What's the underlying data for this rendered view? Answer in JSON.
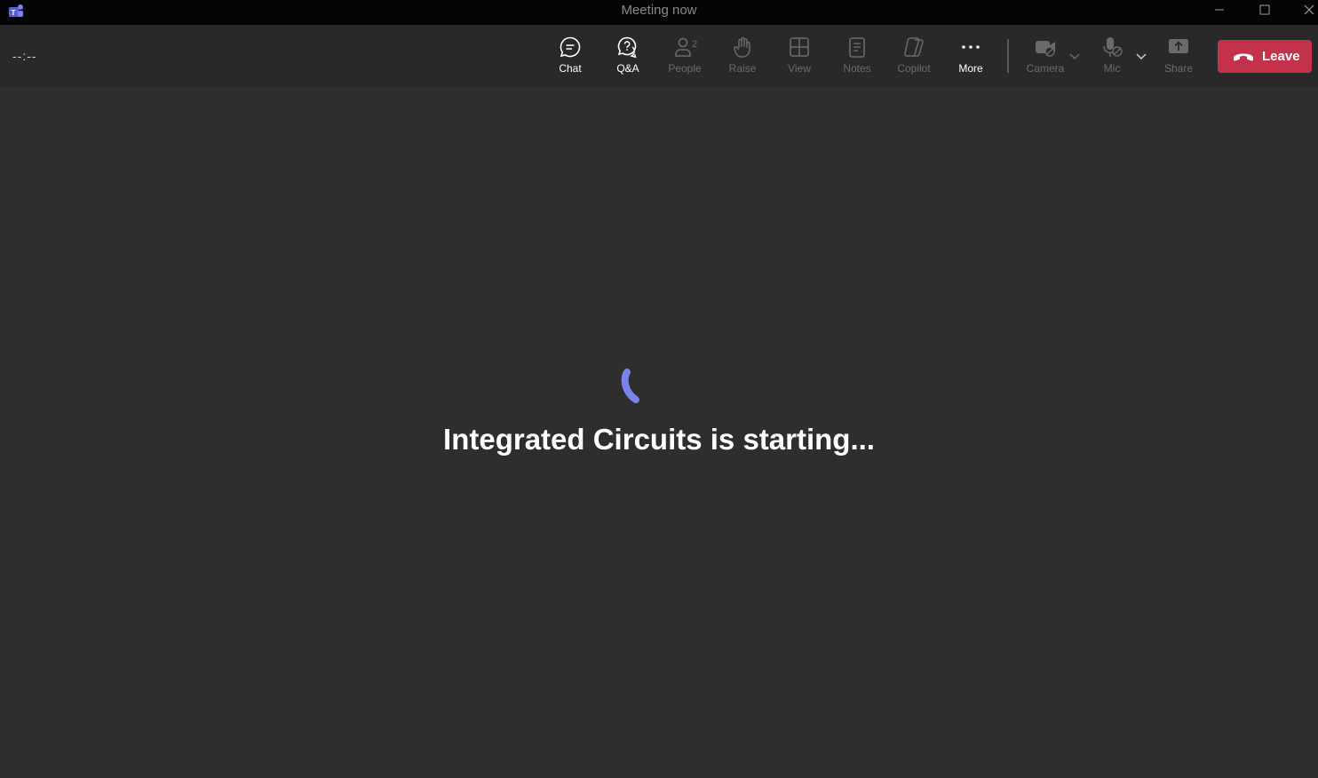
{
  "window": {
    "title": "Meeting now",
    "controls": [
      "minimize-icon",
      "maximize-icon",
      "close-icon"
    ]
  },
  "toolbar": {
    "timer": "--:--",
    "buttons": {
      "chat": {
        "label": "Chat",
        "icon": "chat-icon",
        "enabled": true
      },
      "qa": {
        "label": "Q&A",
        "icon": "qa-icon",
        "enabled": true
      },
      "people": {
        "label": "People",
        "icon": "people-icon",
        "count": "2",
        "enabled": false
      },
      "raise": {
        "label": "Raise",
        "icon": "raise-hand-icon",
        "enabled": false
      },
      "view": {
        "label": "View",
        "icon": "view-grid-icon",
        "enabled": false
      },
      "notes": {
        "label": "Notes",
        "icon": "notes-icon",
        "enabled": false
      },
      "copilot": {
        "label": "Copilot",
        "icon": "copilot-icon",
        "enabled": false
      },
      "more": {
        "label": "More",
        "icon": "more-icon",
        "enabled": true
      },
      "camera": {
        "label": "Camera",
        "icon": "camera-off-icon",
        "enabled": false
      },
      "mic": {
        "label": "Mic",
        "icon": "mic-off-icon",
        "enabled": false
      },
      "share": {
        "label": "Share",
        "icon": "share-icon",
        "enabled": false
      }
    },
    "leave": {
      "label": "Leave",
      "icon": "hang-up-icon",
      "color": "#c4314b"
    }
  },
  "main": {
    "status_text": "Integrated Circuits is starting...",
    "spinner_color": "#7b83eb"
  },
  "colors": {
    "background": "#2e2e2e",
    "toolbar": "#292929",
    "titlebar": "#050505"
  }
}
